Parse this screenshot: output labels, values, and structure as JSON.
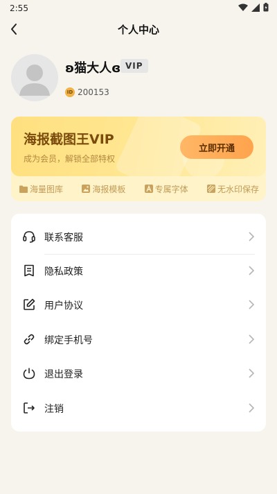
{
  "status_bar": {
    "time": "2:55"
  },
  "header": {
    "title": "个人中心"
  },
  "profile": {
    "username": "ʚ猫大人ɞ",
    "vip_badge": "VIP",
    "id_chip": "ID",
    "user_id": "200153"
  },
  "vip_card": {
    "title": "海报截图王VIP",
    "subtitle": "成为会员，解锁全部特权",
    "button_label": "立即开通",
    "perks": [
      {
        "label": "海量图库",
        "icon": "folder-icon"
      },
      {
        "label": "海报模板",
        "icon": "image-icon"
      },
      {
        "label": "专属字体",
        "icon": "font-icon"
      },
      {
        "label": "无水印保存",
        "icon": "no-watermark-icon"
      }
    ]
  },
  "menu": [
    {
      "label": "联系客服",
      "icon": "headset-icon"
    },
    {
      "label": "隐私政策",
      "icon": "document-icon"
    },
    {
      "label": "用户协议",
      "icon": "edit-icon"
    },
    {
      "label": "绑定手机号",
      "icon": "link-icon"
    },
    {
      "label": "退出登录",
      "icon": "power-icon"
    },
    {
      "label": "注销",
      "icon": "logout-icon"
    }
  ]
}
